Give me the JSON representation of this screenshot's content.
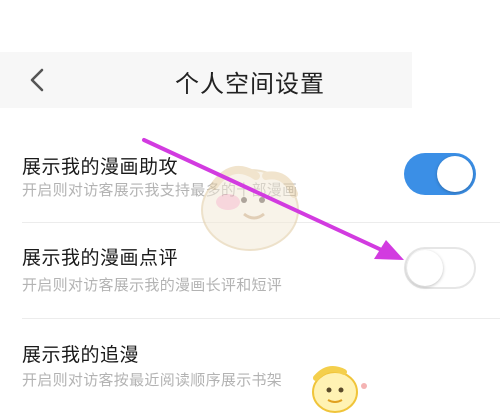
{
  "header": {
    "title": "个人空间设置",
    "back_icon": "chevron-left-icon"
  },
  "settings": [
    {
      "title": "展示我的漫画助攻",
      "description": "开启则对访客展示我支持最多的十部漫画",
      "enabled": true
    },
    {
      "title": "展示我的漫画点评",
      "description": "开启则对访客展示我的漫画长评和短评",
      "enabled": false
    },
    {
      "title": "展示我的追漫",
      "description": "开启则对访客按最近阅读顺序展示书架",
      "enabled": null
    }
  ],
  "colors": {
    "toggle_on": "#3b8fe6",
    "annotation_arrow": "#d23be0"
  },
  "annotation": {
    "arrow_icon": "annotation-arrow-icon",
    "watermark_icons": [
      "mascot-watermark-icon",
      "mascot-logo-icon"
    ]
  }
}
